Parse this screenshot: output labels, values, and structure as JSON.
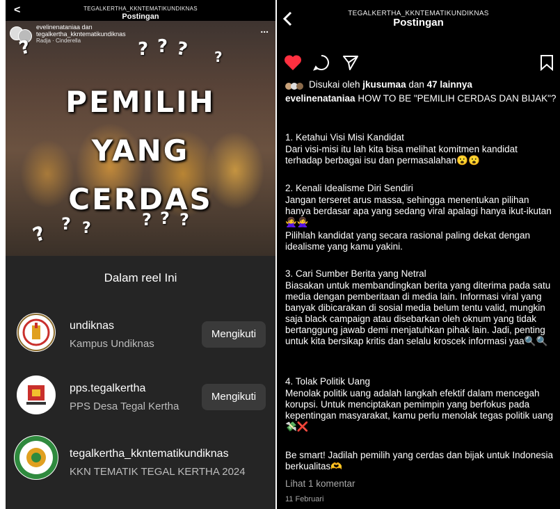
{
  "left": {
    "header": {
      "username": "TEGALKERTHA_KKNTEMATIKUNDIKNAS",
      "title": "Postingan"
    },
    "reel": {
      "collab_line1": "evelinenataniaa dan",
      "collab_line2": "tegalkertha_kkntematikundiknas",
      "audio": "Radja · Cinderella",
      "more": "...",
      "overlay": [
        "PEMILIH",
        "YANG",
        "CERDAS"
      ]
    },
    "sheet": {
      "title": "Dalam reel Ini",
      "accounts": [
        {
          "username": "undiknas",
          "name": "Kampus Undiknas",
          "button": "Mengikuti"
        },
        {
          "username": "pps.tegalkertha",
          "name": "PPS Desa Tegal Kertha",
          "button": "Mengikuti"
        },
        {
          "username": "tegalkertha_kkntematikundiknas",
          "name": "KKN TEMATIK TEGAL KERTHA 2024",
          "button": ""
        }
      ]
    }
  },
  "right": {
    "header": {
      "username": "TEGALKERTHA_KKNTEMATIKUNDIKNAS",
      "title": "Postingan"
    },
    "likes": {
      "prefix": "Disukai oleh ",
      "user": "jkusumaa",
      "mid": " dan ",
      "count": "47 lainnya"
    },
    "caption": {
      "author": "evelinenataniaa",
      "intro": " HOW TO BE \"PEMILIH CERDAS DAN BIJAK\"?",
      "p1_title": "1. Ketahui Visi Misi Kandidat",
      "p1_body": "Dari visi-misi itu lah kita bisa melihat komitmen kandidat terhadap berbagai isu dan permasalahan😮😮",
      "p2_title": "2. Kenali Idealisme Diri Sendiri",
      "p2_body": "Jangan terseret arus massa, sehingga menentukan pilihan hanya berdasar apa yang sedang viral apalagi hanya ikut-ikutan🙅‍♀️🙅‍♀️",
      "p2_body2": "Pilihlah kandidat yang secara rasional paling dekat dengan idealisme yang kamu yakini.",
      "p3_title": "3. Cari Sumber Berita yang Netral",
      "p3_body": "Biasakan untuk membandingkan berita yang diterima pada satu media dengan pemberitaan di media lain. Informasi viral yang banyak dibicarakan di sosial media belum tentu valid, mungkin saja black campaign  atau disebarkan oleh oknum yang tidak bertanggung jawab demi menjatuhkan pihak lain. Jadi, penting untuk kita bersikap kritis dan selalu kroscek informasi yaa🔍🔍",
      "p4_title": "4. Tolak Politik Uang",
      "p4_body": "Menolak politik uang adalah langkah efektif dalam mencegah korupsi. Untuk menciptakan pemimpin yang berfokus pada kepentingan masyarakat, kamu perlu menolak tegas politik uang💸❌",
      "closing": "Be smart! Jadilah pemilih yang cerdas dan bijak untuk Indonesia berkualitas🫶"
    },
    "comments_link": "Lihat 1 komentar",
    "date": "11 Februari"
  },
  "colors": {
    "like_red": "#ff3040",
    "sheet_bg": "#252525",
    "button_bg": "#3a3a3a"
  }
}
